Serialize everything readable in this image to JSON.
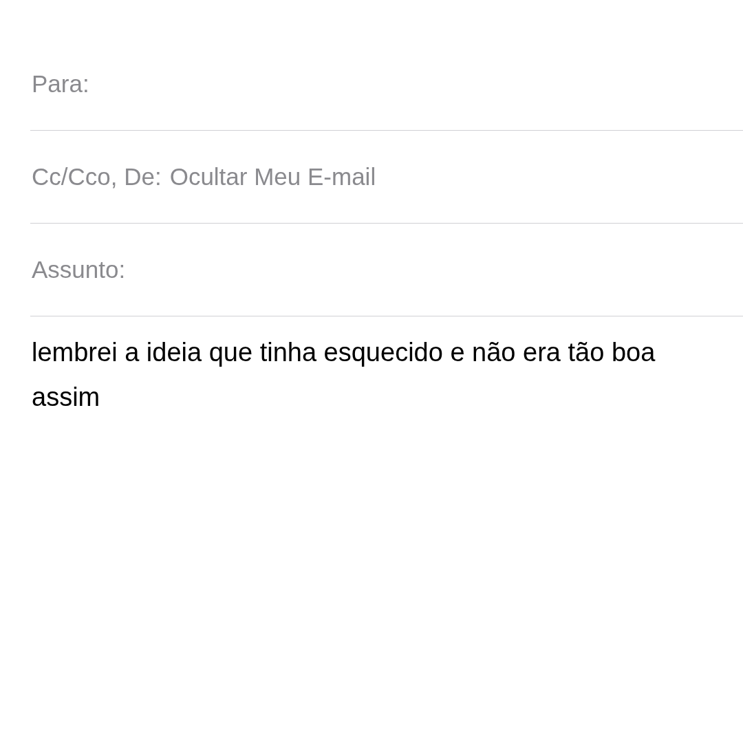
{
  "fields": [
    {
      "label": "Para:"
    },
    {
      "label": "Cc/Cco, De:",
      "value": "Ocultar Meu E-mail"
    },
    {
      "label": "Assunto:"
    }
  ],
  "body": "lembrei a ideia que tinha esquecido e não era tão boa assim"
}
